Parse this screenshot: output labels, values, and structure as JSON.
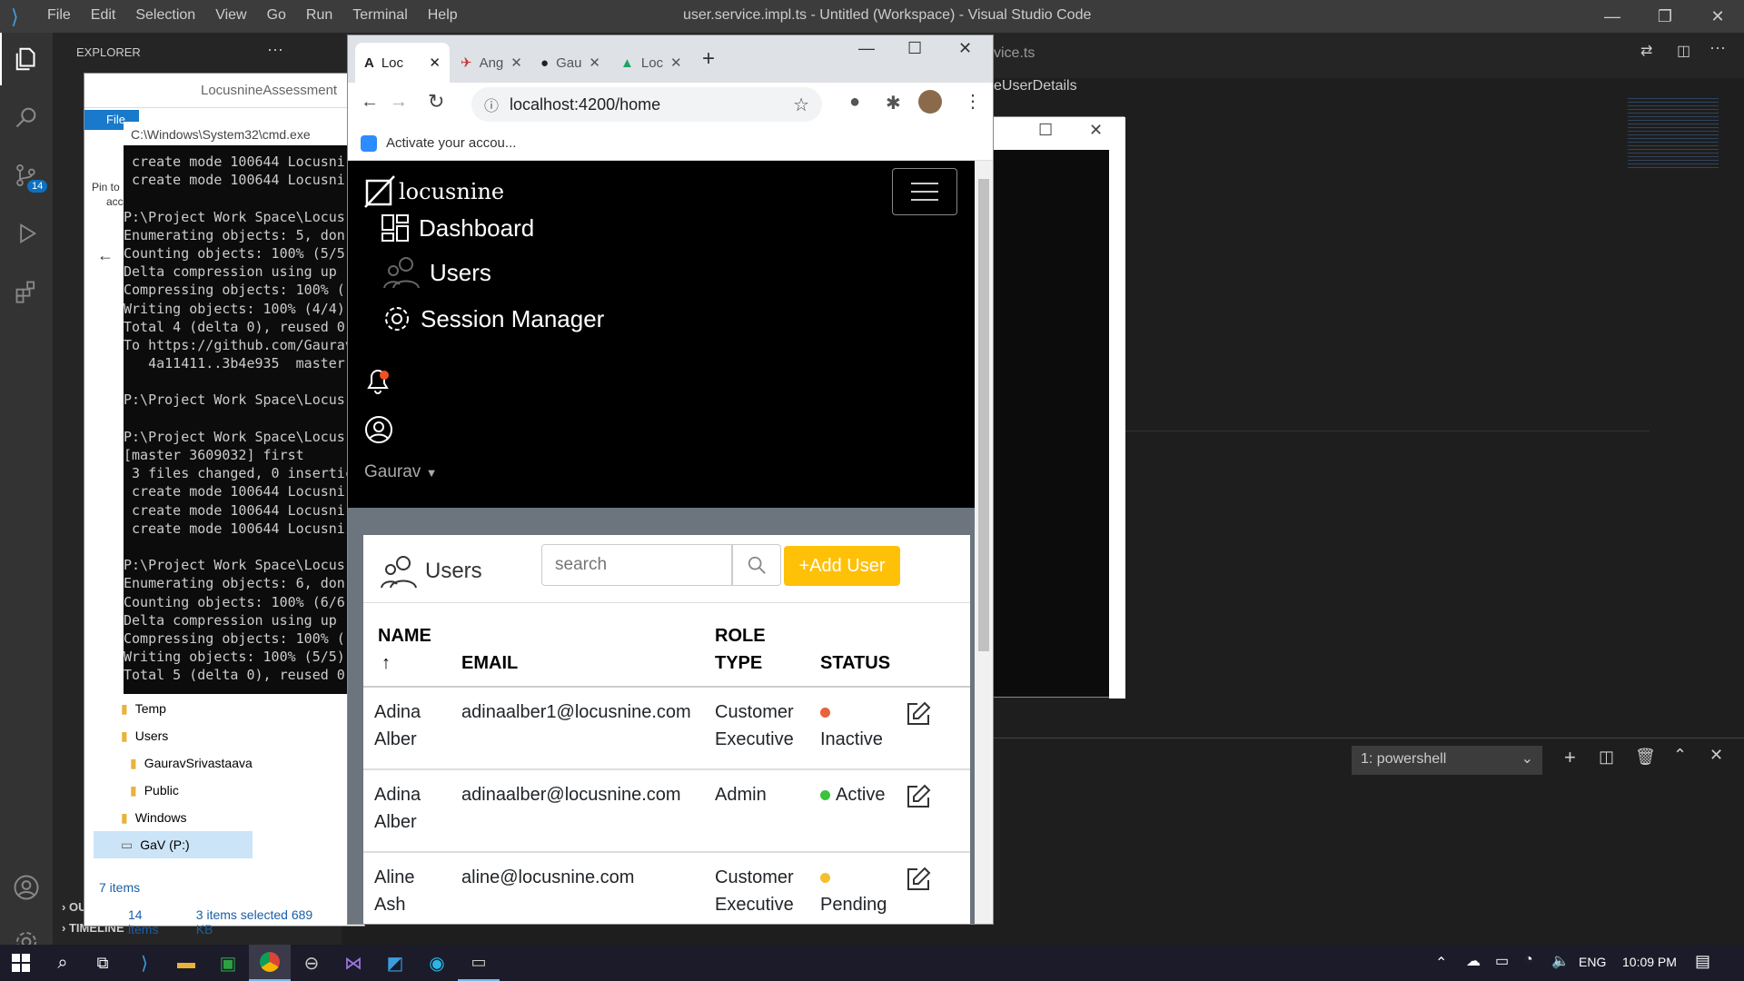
{
  "vscode": {
    "menu": [
      "File",
      "Edit",
      "Selection",
      "View",
      "Go",
      "Run",
      "Terminal",
      "Help"
    ],
    "title": "user.service.impl.ts - Untitled (Workspace) - Visual Studio Code",
    "explorer_label": "EXPLORER",
    "tab_partial": "vice.ts",
    "breadcrumb_partial": "eUserDetails",
    "source_control_badge": "14",
    "outline_label": "OUTLI",
    "timeline_label": "TIMELINE",
    "terminal_select": "1: powershell"
  },
  "explorer_window": {
    "title": "LocusnineAssessment",
    "ribbon_tab": "File",
    "pin_label": "Pin to",
    "pin_label2": "acc",
    "tree": [
      "Temp",
      "Users",
      "GauravSrivastaava",
      "Public",
      "Windows",
      "GaV (P:)"
    ],
    "items_count": "7 items",
    "status_items": "14 items",
    "status_selected": "3 items selected  689 KB"
  },
  "cmd": {
    "title": "C:\\Windows\\System32\\cmd.exe",
    "lines": [
      " create mode 100644 Locusni",
      " create mode 100644 Locusni",
      "",
      "P:\\Project Work Space\\Locus",
      "Enumerating objects: 5, don",
      "Counting objects: 100% (5/5",
      "Delta compression using up ",
      "Compressing objects: 100% (",
      "Writing objects: 100% (4/4)",
      "Total 4 (delta 0), reused 0",
      "To https://github.com/Gaurav",
      "   4a11411..3b4e935  master",
      "",
      "P:\\Project Work Space\\Locus",
      "",
      "P:\\Project Work Space\\Locus",
      "[master 3609032] first",
      " 3 files changed, 0 insertic",
      " create mode 100644 Locusni",
      " create mode 100644 Locusni",
      " create mode 100644 Locusni",
      "",
      "P:\\Project Work Space\\Locus",
      "Enumerating objects: 6, don",
      "Counting objects: 100% (6/6",
      "Delta compression using up ",
      "Compressing objects: 100% (",
      "Writing objects: 100% (5/5)",
      "Total 5 (delta 0), reused 0"
    ]
  },
  "chrome": {
    "tabs": [
      "Loc",
      "Ang",
      "Gau",
      "Loc"
    ],
    "url": "localhost:4200/home",
    "bookmark": "Activate your accou..."
  },
  "app": {
    "brand": "locusnine",
    "nav": [
      "Dashboard",
      "Users",
      "Session Manager"
    ],
    "user": "Gaurav",
    "card_title": "Users",
    "search_placeholder": "search",
    "add_button": "+Add User",
    "headers": {
      "name": "NAME",
      "email": "EMAIL",
      "role1": "ROLE",
      "role2": "TYPE",
      "status": "STATUS",
      "sort_arrow": "↑"
    },
    "rows": [
      {
        "first": "Adina",
        "last": "Alber",
        "email": "adinaalber1@locusnine.com",
        "role1": "Customer",
        "role2": "Executive",
        "status": "Inactive",
        "color": "#e8623b"
      },
      {
        "first": "Adina",
        "last": "Alber",
        "email": "adinaalber@locusnine.com",
        "role1": "Admin",
        "role2": "",
        "status": "Active",
        "color": "#3cc23c"
      },
      {
        "first": "Aline",
        "last": "Ash",
        "email": "aline@locusnine.com",
        "role1": "Customer",
        "role2": "Executive",
        "status": "Pending",
        "color": "#f5c02c"
      }
    ]
  },
  "taskbar": {
    "lang": "ENG",
    "time": "10:09 PM"
  }
}
